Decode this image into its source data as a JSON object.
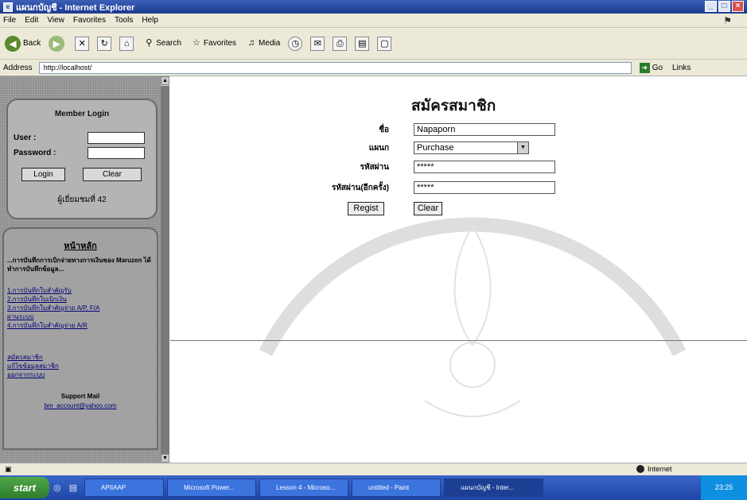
{
  "window": {
    "title": "แผนกบัญชี - Internet Explorer",
    "controls": [
      "_",
      "□",
      "×"
    ]
  },
  "menu": [
    "File",
    "Edit",
    "View",
    "Favorites",
    "Tools",
    "Help"
  ],
  "toolbar": {
    "back": "Back",
    "search": "Search",
    "favorites": "Favorites",
    "media": "Media"
  },
  "address": {
    "label": "Address",
    "url": "http://localhost/",
    "go": "Go",
    "links": "Links"
  },
  "sidebar": {
    "login": {
      "title": "Member Login",
      "user_label": "User :",
      "password_label": "Password :",
      "login_button": "Login",
      "clear_button": "Clear",
      "visitors": "ผู้เยี่ยมชมที่ 42"
    },
    "menu": {
      "title": "หน้าหลัก",
      "description": "...การบันทึกการเบิกจ่ายทางการเงินของ Maruzen ได้ทำการบันทึกข้อมูล...",
      "links": [
        "1.การบันทึกใบสำคัญรับ",
        "2.การบันทึกใบเบิกเงิน",
        "3.การบันทึกใบสำคัญจ่าย A/P, F/A",
        "ผ่านระบบ",
        "4.การบันทึกใบสำคัญจ่าย A/R"
      ],
      "links2": [
        "สมัครสมาชิก",
        "แก้ไขข้อมูลสมาชิก",
        "ออกจากระบบ"
      ],
      "contact": "Support Mail",
      "email": "bm_account@yahoo.com"
    }
  },
  "form": {
    "title": "สมัครสมาชิก",
    "name_label": "ชื่อ",
    "name_value": "Napaporn",
    "dept_label": "แผนก",
    "dept_value": "Purchase",
    "password_label": "รหัสผ่าน",
    "password_value": "*****",
    "confirm_label": "รหัสผ่าน(อีกครั้ง)",
    "confirm_value": "*****",
    "regist_button": "Regist",
    "clear_button": "Clear"
  },
  "status": {
    "zone": "Internet"
  },
  "taskbar": {
    "start": "start",
    "tasks": [
      "APIIAAP",
      "Microsoft Power...",
      "Lesson 4 - Microso...",
      "untitled - Paint",
      "แผนกบัญชี - Inter..."
    ],
    "clock": "23:25"
  }
}
